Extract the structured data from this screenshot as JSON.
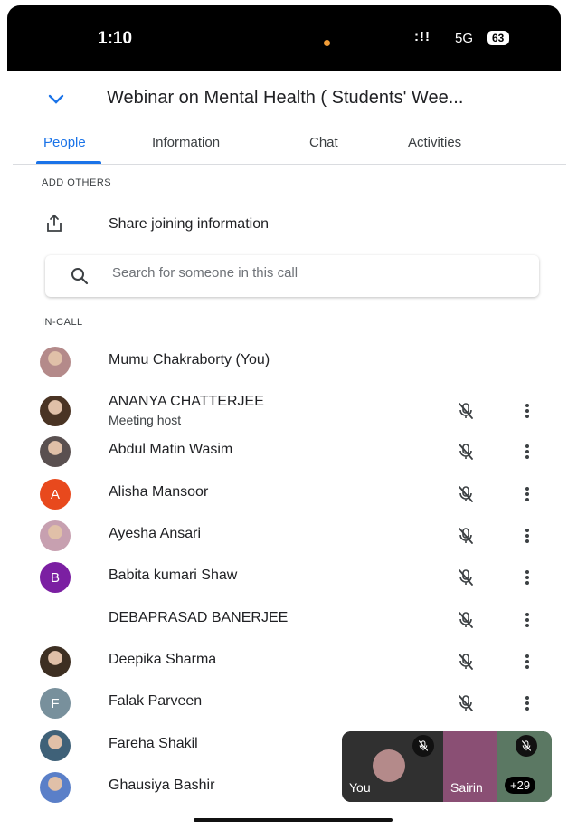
{
  "status": {
    "time": "1:10",
    "network": "5G",
    "battery": "63",
    "signal": ":!!"
  },
  "header": {
    "title": "Webinar on Mental Health ( Students' Wee..."
  },
  "tabs": [
    "People",
    "Information",
    "Chat",
    "Activities"
  ],
  "sections": {
    "add_others": "ADD OTHERS",
    "in_call": "IN-CALL"
  },
  "share": {
    "label": "Share joining information"
  },
  "search": {
    "placeholder": "Search for someone in this call"
  },
  "participants": [
    {
      "name": "Mumu Chakraborty (You)",
      "sub": "",
      "avatar": "photo",
      "color": "#b48a8a"
    },
    {
      "name": "ANANYA CHATTERJEE",
      "sub": "Meeting host",
      "avatar": "photo",
      "color": "#4a3424"
    },
    {
      "name": "Abdul Matin Wasim",
      "sub": "",
      "avatar": "photo",
      "color": "#5a5050"
    },
    {
      "name": "Alisha Mansoor",
      "sub": "",
      "avatar": "letter",
      "letter": "A",
      "color": "#e8491d"
    },
    {
      "name": "Ayesha Ansari",
      "sub": "",
      "avatar": "photo",
      "color": "#c7a0b0"
    },
    {
      "name": "Babita kumari Shaw",
      "sub": "",
      "avatar": "letter",
      "letter": "B",
      "color": "#7b1fa2"
    },
    {
      "name": "DEBAPRASAD BANERJEE",
      "sub": "",
      "avatar": "none",
      "color": "#ffffff"
    },
    {
      "name": "Deepika Sharma",
      "sub": "",
      "avatar": "photo",
      "color": "#3d2f22"
    },
    {
      "name": "Falak Parveen",
      "sub": "",
      "avatar": "letter",
      "letter": "F",
      "color": "#78909c"
    },
    {
      "name": "Fareha Shakil",
      "sub": "",
      "avatar": "photo",
      "color": "#3f6178"
    },
    {
      "name": "Ghausiya Bashir",
      "sub": "",
      "avatar": "photo",
      "color": "#5a7fc8"
    }
  ],
  "pip": {
    "you_label": "You",
    "second_label": "Sairin",
    "more_count": "+29"
  }
}
